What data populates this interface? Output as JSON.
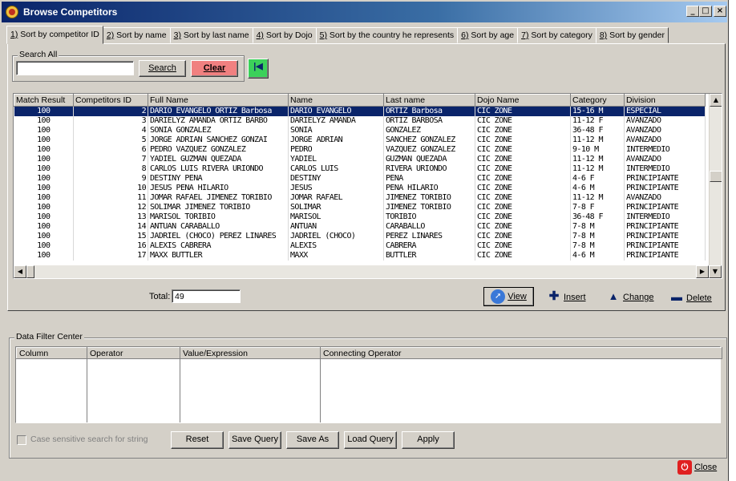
{
  "window": {
    "title": "Browse Competitors",
    "minimize": "_",
    "maximize": "□",
    "close": "×"
  },
  "tabs": [
    {
      "key": "1)",
      "label": " Sort by competitor ID"
    },
    {
      "key": "2)",
      "label": " Sort by name"
    },
    {
      "key": "3)",
      "label": " Sort by last name"
    },
    {
      "key": "4)",
      "label": " Sort by Dojo"
    },
    {
      "key": "5)",
      "label": " Sort by the country he represents"
    },
    {
      "key": "6)",
      "label": " Sort by age"
    },
    {
      "key": "7)",
      "label": " Sort by category"
    },
    {
      "key": "8)",
      "label": " Sort by gender"
    }
  ],
  "search": {
    "group_label": "Search All",
    "value": "",
    "search_label": "Search",
    "clear_label": "Clear",
    "first_icon": "first-record-icon"
  },
  "grid": {
    "columns": [
      "Match Result",
      "Competitors ID",
      "Full Name",
      "Name",
      "Last name",
      "Dojo Name",
      "Category",
      "Division"
    ],
    "rows": [
      [
        "100",
        "2",
        "DARIO EVANGELO ORTIZ Barbosa",
        "DARIO EVANGELO",
        "ORTIZ Barbosa",
        "CIC ZONE",
        "15-16 M",
        "ESPECIAL"
      ],
      [
        "100",
        "3",
        "DARIELYZ AMANDA ORTIZ  BARBO",
        "DARIELYZ AMANDA",
        "ORTIZ  BARBOSA",
        "CIC ZONE",
        "11-12 F",
        "AVANZADO"
      ],
      [
        "100",
        "4",
        "SONIA GONZALEZ",
        "SONIA",
        "GONZALEZ",
        "CIC ZONE",
        "36-48 F",
        "AVANZADO"
      ],
      [
        "100",
        "5",
        "JORGE ADRIAN SANCHEZ GONZAI",
        "JORGE ADRIAN",
        "SANCHEZ GONZALEZ",
        "CIC ZONE",
        "11-12 M",
        "AVANZADO"
      ],
      [
        "100",
        "6",
        "PEDRO VAZQUEZ GONZALEZ",
        "PEDRO",
        "VAZQUEZ GONZALEZ",
        "CIC ZONE",
        "9-10 M",
        "INTERMEDIO"
      ],
      [
        "100",
        "7",
        "YADIEL GUZMAN QUEZADA",
        "YADIEL",
        "GUZMAN QUEZADA",
        "CIC ZONE",
        "11-12 M",
        "AVANZADO"
      ],
      [
        "100",
        "8",
        "CARLOS LUIS RIVERA URIONDO",
        "CARLOS LUIS",
        "RIVERA URIONDO",
        "CIC ZONE",
        "11-12 M",
        "INTERMEDIO"
      ],
      [
        "100",
        "9",
        "DESTINY PENA",
        "DESTINY",
        "PENA",
        "CIC ZONE",
        "4-6 F",
        "PRINCIPIANTE"
      ],
      [
        "100",
        "10",
        "JESUS PENA HILARIO",
        "JESUS",
        "PENA HILARIO",
        "CIC ZONE",
        "4-6 M",
        "PRINCIPIANTE"
      ],
      [
        "100",
        "11",
        "JOMAR RAFAEL JIMENEZ TORIBIO",
        "JOMAR RAFAEL",
        "JIMENEZ TORIBIO",
        "CIC ZONE",
        "11-12 M",
        "AVANZADO"
      ],
      [
        "100",
        "12",
        "SOLIMAR JIMENEZ TORIBIO",
        "SOLIMAR",
        "JIMENEZ TORIBIO",
        "CIC ZONE",
        "7-8 F",
        "PRINCIPIANTE"
      ],
      [
        "100",
        "13",
        "MARISOL TORIBIO",
        "MARISOL",
        "TORIBIO",
        "CIC ZONE",
        "36-48 F",
        "INTERMEDIO"
      ],
      [
        "100",
        "14",
        "ANTUAN CARABALLO",
        "ANTUAN",
        "CARABALLO",
        "CIC ZONE",
        "7-8 M",
        "PRINCIPIANTE"
      ],
      [
        "100",
        "15",
        "JADRIEL (CHOCO) PEREZ LINARES",
        "JADRIEL (CHOCO)",
        "PEREZ LINARES",
        "CIC ZONE",
        "7-8 M",
        "PRINCIPIANTE"
      ],
      [
        "100",
        "16",
        "ALEXIS CABRERA",
        "ALEXIS",
        "CABRERA",
        "CIC ZONE",
        "7-8 M",
        "PRINCIPIANTE"
      ],
      [
        "100",
        "17",
        "MAXX BUTTLER",
        "MAXX",
        "BUTTLER",
        "CIC ZONE",
        "4-6 M",
        "PRINCIPIANTE"
      ]
    ],
    "selected_row": 0,
    "overflow_marks": [
      "",
      "",
      "",
      "",
      "",
      "",
      "",
      "",
      "",
      "",
      "",
      "",
      "",
      "",
      "",
      ""
    ]
  },
  "footer": {
    "total_label": "Total:",
    "total_value": "49",
    "view_label": "View",
    "insert_label": "Insert",
    "change_label": "Change",
    "delete_label": "Delete"
  },
  "filter": {
    "group_label": "Data Filter Center",
    "columns": [
      "Column",
      "Operator",
      "Value/Expression",
      "Connecting Operator"
    ],
    "case_label": "Case sensitive search for string",
    "buttons": [
      "Reset",
      "Save Query",
      "Save As",
      "Load Query",
      "Apply"
    ]
  },
  "close_label": "Close",
  "colors": {
    "selected_row": "#0a246a",
    "clear_button": "#f08080",
    "first_button": "#3cd15a"
  }
}
